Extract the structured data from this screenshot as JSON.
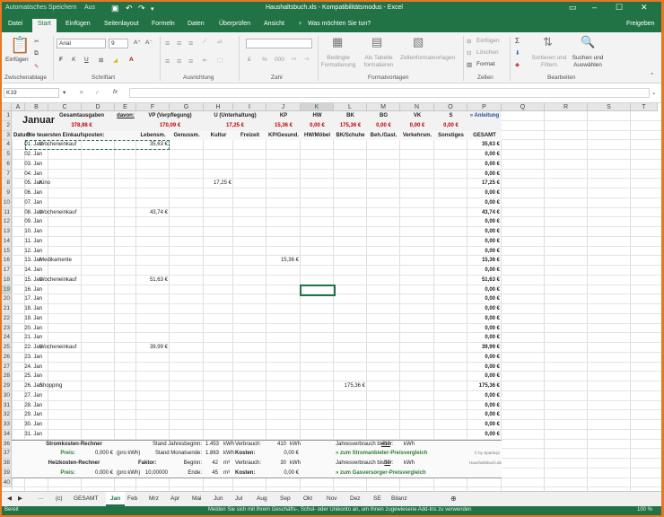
{
  "window": {
    "autosave_label": "Automatisches Speichern",
    "autosave_state": "Aus",
    "title": "Haushaltsbuch.xls  -  Kompatibilitätsmodus  -  Excel"
  },
  "ribbon": {
    "tabs": [
      "Datei",
      "Start",
      "Einfügen",
      "Seitenlayout",
      "Formeln",
      "Daten",
      "Überprüfen",
      "Ansicht"
    ],
    "active_tab": "Start",
    "tell_me": "Was möchten Sie tun?",
    "share": "Freigeben",
    "clipboard": {
      "paste": "Einfügen",
      "group": "Zwischenablage"
    },
    "font": {
      "name": "Arial",
      "size": "9",
      "group": "Schriftart"
    },
    "alignment": {
      "group": "Ausrichtung"
    },
    "number": {
      "group": "Zahl"
    },
    "styles": {
      "conditional": "Bedingte Formatierung",
      "as_table": "Als Tabelle formatieren",
      "cell_styles": "Zellenformatvorlagen",
      "group": "Formatvorlagen"
    },
    "cells": {
      "insert": "Einfügen",
      "delete": "Löschen",
      "format": "Format",
      "group": "Zellen"
    },
    "editing": {
      "sort": "Sortieren und Filtern",
      "find": "Suchen und Auswählen",
      "group": "Bearbeiten"
    }
  },
  "formula_bar": {
    "name_box": "K19",
    "fx": "fx",
    "value": ""
  },
  "columns": [
    "A",
    "B",
    "C",
    "D",
    "E",
    "F",
    "G",
    "H",
    "I",
    "J",
    "K",
    "L",
    "M",
    "N",
    "O",
    "P",
    "Q",
    "R",
    "S",
    "T"
  ],
  "selected_column": "K",
  "selected_row": "19",
  "rows": [
    "1",
    "2",
    "3",
    "4",
    "5",
    "6",
    "7",
    "8",
    "9",
    "10",
    "11",
    "12",
    "13",
    "14",
    "15",
    "16",
    "17",
    "18",
    "19",
    "20",
    "21",
    "22",
    "23",
    "24",
    "25",
    "26",
    "27",
    "28",
    "29",
    "30",
    "31",
    "32",
    "33",
    "34",
    "36",
    "37",
    "38",
    "39",
    "40"
  ],
  "header": {
    "month": "Januar",
    "total_label": "Gesamtausgaben",
    "total_value": "378,98 €",
    "davon": "davon:",
    "anleitung": "» Anleitung",
    "categories": [
      {
        "name": "VP (Verpflegung)",
        "value": "170,09 €"
      },
      {
        "name": "U (Unterhaltung)",
        "value": "17,25 €"
      },
      {
        "name": "KP",
        "value": "15,36 €"
      },
      {
        "name": "HW",
        "value": "0,00 €"
      },
      {
        "name": "BK",
        "value": "175,36 €"
      },
      {
        "name": "BG",
        "value": "0,00 €"
      },
      {
        "name": "VK",
        "value": "0,00 €"
      },
      {
        "name": "S",
        "value": "0,00 €"
      }
    ],
    "columns": [
      "Datum",
      "Die teuersten Einkaufsposten:",
      "Lebensm.",
      "Genussm.",
      "Kultur",
      "Freizeit",
      "KP/Gesund.",
      "HW/Möbel",
      "BK/Schuhe",
      "Beh./Gast.",
      "Verkehrsm.",
      "Sonstiges",
      "GESAMT"
    ]
  },
  "days": [
    {
      "date": "01. Jan",
      "item": "Wocheneinkauf",
      "lebensm": "35,63 €",
      "kultur": "",
      "kp": "",
      "bk": "",
      "total": "35,63 €"
    },
    {
      "date": "02. Jan",
      "item": "",
      "lebensm": "",
      "kultur": "",
      "kp": "",
      "bk": "",
      "total": "0,00 €"
    },
    {
      "date": "03. Jan",
      "item": "",
      "lebensm": "",
      "kultur": "",
      "kp": "",
      "bk": "",
      "total": "0,00 €"
    },
    {
      "date": "04. Jan",
      "item": "",
      "lebensm": "",
      "kultur": "",
      "kp": "",
      "bk": "",
      "total": "0,00 €"
    },
    {
      "date": "05. Jan",
      "item": "Kino",
      "lebensm": "",
      "kultur": "17,25 €",
      "kp": "",
      "bk": "",
      "total": "17,25 €"
    },
    {
      "date": "06. Jan",
      "item": "",
      "lebensm": "",
      "kultur": "",
      "kp": "",
      "bk": "",
      "total": "0,00 €"
    },
    {
      "date": "07. Jan",
      "item": "",
      "lebensm": "",
      "kultur": "",
      "kp": "",
      "bk": "",
      "total": "0,00 €"
    },
    {
      "date": "08. Jan",
      "item": "Wocheneinkauf",
      "lebensm": "43,74 €",
      "kultur": "",
      "kp": "",
      "bk": "",
      "total": "43,74 €"
    },
    {
      "date": "09. Jan",
      "item": "",
      "lebensm": "",
      "kultur": "",
      "kp": "",
      "bk": "",
      "total": "0,00 €"
    },
    {
      "date": "10. Jan",
      "item": "",
      "lebensm": "",
      "kultur": "",
      "kp": "",
      "bk": "",
      "total": "0,00 €"
    },
    {
      "date": "11. Jan",
      "item": "",
      "lebensm": "",
      "kultur": "",
      "kp": "",
      "bk": "",
      "total": "0,00 €"
    },
    {
      "date": "12. Jan",
      "item": "",
      "lebensm": "",
      "kultur": "",
      "kp": "",
      "bk": "",
      "total": "0,00 €"
    },
    {
      "date": "13. Jan",
      "item": "Medikamente",
      "lebensm": "",
      "kultur": "",
      "kp": "15,36 €",
      "bk": "",
      "total": "15,36 €"
    },
    {
      "date": "14. Jan",
      "item": "",
      "lebensm": "",
      "kultur": "",
      "kp": "",
      "bk": "",
      "total": "0,00 €"
    },
    {
      "date": "15. Jan",
      "item": "Wocheneinkauf",
      "lebensm": "51,63 €",
      "kultur": "",
      "kp": "",
      "bk": "",
      "total": "51,63 €"
    },
    {
      "date": "16. Jan",
      "item": "",
      "lebensm": "",
      "kultur": "",
      "kp": "",
      "bk": "",
      "total": "0,00 €"
    },
    {
      "date": "17. Jan",
      "item": "",
      "lebensm": "",
      "kultur": "",
      "kp": "",
      "bk": "",
      "total": "0,00 €"
    },
    {
      "date": "18. Jan",
      "item": "",
      "lebensm": "",
      "kultur": "",
      "kp": "",
      "bk": "",
      "total": "0,00 €"
    },
    {
      "date": "19. Jan",
      "item": "",
      "lebensm": "",
      "kultur": "",
      "kp": "",
      "bk": "",
      "total": "0,00 €"
    },
    {
      "date": "20. Jan",
      "item": "",
      "lebensm": "",
      "kultur": "",
      "kp": "",
      "bk": "",
      "total": "0,00 €"
    },
    {
      "date": "21. Jan",
      "item": "",
      "lebensm": "",
      "kultur": "",
      "kp": "",
      "bk": "",
      "total": "0,00 €"
    },
    {
      "date": "22. Jan",
      "item": "Wocheneinkauf",
      "lebensm": "39,99 €",
      "kultur": "",
      "kp": "",
      "bk": "",
      "total": "39,99 €"
    },
    {
      "date": "23. Jan",
      "item": "",
      "lebensm": "",
      "kultur": "",
      "kp": "",
      "bk": "",
      "total": "0,00 €"
    },
    {
      "date": "24. Jan",
      "item": "",
      "lebensm": "",
      "kultur": "",
      "kp": "",
      "bk": "",
      "total": "0,00 €"
    },
    {
      "date": "25. Jan",
      "item": "",
      "lebensm": "",
      "kultur": "",
      "kp": "",
      "bk": "",
      "total": "0,00 €"
    },
    {
      "date": "26. Jan",
      "item": "Shopping",
      "lebensm": "",
      "kultur": "",
      "kp": "",
      "bk": "175,36 €",
      "total": "175,36 €"
    },
    {
      "date": "27. Jan",
      "item": "",
      "lebensm": "",
      "kultur": "",
      "kp": "",
      "bk": "",
      "total": "0,00 €"
    },
    {
      "date": "28. Jan",
      "item": "",
      "lebensm": "",
      "kultur": "",
      "kp": "",
      "bk": "",
      "total": "0,00 €"
    },
    {
      "date": "29. Jan",
      "item": "",
      "lebensm": "",
      "kultur": "",
      "kp": "",
      "bk": "",
      "total": "0,00 €"
    },
    {
      "date": "30. Jan",
      "item": "",
      "lebensm": "",
      "kultur": "",
      "kp": "",
      "bk": "",
      "total": "0,00 €"
    },
    {
      "date": "31. Jan",
      "item": "",
      "lebensm": "",
      "kultur": "",
      "kp": "",
      "bk": "",
      "total": "0,00 €"
    }
  ],
  "calc": {
    "strom_title": "Stromkosten-Rechner",
    "preis_label": "Preis:",
    "preis_value": "0,000 €",
    "per_kwh": "(pro kWh)",
    "stand_begin_label": "Stand Jahresbeginn:",
    "stand_begin_value": "1.453",
    "stand_end_label": "Stand Monatsende:",
    "stand_end_value": "1.863",
    "kwh": "kWh",
    "verbrauch_label": "Verbrauch:",
    "strom_verbrauch": "410",
    "kosten_label": "Kosten:",
    "strom_kosten": "0,00 €",
    "jahr_label": "Jahresverbrauch bisher:",
    "strom_jahr": "410",
    "strom_link": "» zum Stromanbieter-Preisvergleich",
    "heiz_title": "Heizkosten-Rechner",
    "faktor_label": "Faktor:",
    "faktor_value": "10,00000",
    "heiz_preis_value": "0,000 €",
    "beginn_label": "Beginn:",
    "beginn_value": "42",
    "ende_label": "Ende:",
    "ende_value": "45",
    "m3": "m³",
    "heiz_verbrauch": "30",
    "heiz_kosten": "0,00 €",
    "heiz_jahr": "30",
    "gas_link": "» zum Gasversorger-Preisvergleich",
    "credit1": "© by Sparkojo",
    "credit2": "Haushaltsbuch.de"
  },
  "sheets": [
    "(c)",
    "GESAMT",
    "Jan",
    "Feb",
    "Mrz",
    "Apr",
    "Mai",
    "Jun",
    "Jul",
    "Aug",
    "Sep",
    "Okt",
    "Nov",
    "Dez",
    "SE",
    "Bilanz"
  ],
  "active_sheet": "Jan",
  "status": {
    "ready": "Bereit",
    "message": "Melden Sie sich mit Ihrem Geschäfts-, Schul- oder Unikonto an, um Ihnen zugewiesene Add-Ins zu verwenden",
    "zoom": "100 %"
  }
}
